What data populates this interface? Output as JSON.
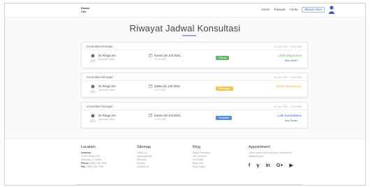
{
  "nav": {
    "logo_line1": "Dokter",
    "logo_line2": "Cek",
    "links": [
      "Home",
      "Riwayat",
      "Cerita",
      "Masuk Akun"
    ]
  },
  "page": {
    "title": "Riwayat Jadwal Konsultasi"
  },
  "cards": [
    {
      "heading": "Konsultasi Dengan",
      "date_posted": "12 Juni 2021 · 10.00 WIB",
      "doctor": "Dr.Ringo,sm",
      "specialty": "Spesialis Mata",
      "schedule_date": "Kamis,29 Juli 2021",
      "schedule_time": "11.00 WIB",
      "status": "Selesai",
      "status_color": "#5cb85c",
      "action": "Lihat Diagnosa",
      "action_color": "#5cb85c",
      "action_sub": "Ulas Dokter"
    },
    {
      "heading": "Konsultasi Dengan",
      "date_posted": "12 Juni 2021 · 10.00 WIB",
      "doctor": "Dr.Ringo,sm",
      "specialty": "Spesialis Mata",
      "schedule_date": "Sabtu,31 Juli 2021",
      "schedule_time": "11.00 WIB",
      "status": "Menunggu",
      "status_color": "#f5c542",
      "action": "Bayar Sekarang",
      "action_color": "#f0ad4e",
      "action_sub": ""
    },
    {
      "heading": "Konsultasi Dengan",
      "date_posted": "12 Juni 2021 · 10.00 WIB",
      "doctor": "Dr.Ringo,sm",
      "specialty": "Spesialis Mata",
      "schedule_date": "Kamis,29 Juli 2021",
      "schedule_time": "11.00 WIB",
      "status": "Terjadwal",
      "status_color": "#4a90e2",
      "action": "Link Konsultasi",
      "action_color": "#3a5bd9",
      "action_sub": "Ulas Dokter"
    }
  ],
  "footer": {
    "location": {
      "heading": "Location",
      "address_label": "Address:",
      "address_1": "1025 Tuff Ave Rd.",
      "address_2": "Hulubalu, IL 76303",
      "phone_label": "Phone:",
      "phone": "(555) 236-7818",
      "fax_label": "Fax:",
      "fax": "(555) 265-7818"
    },
    "sitemap": {
      "heading": "Sitemap",
      "items": [
        "About Us",
        "Appointments",
        "Services",
        "Doctors",
        "Contact Us"
      ]
    },
    "blog": {
      "heading": "Blog",
      "items": [
        "Rapid Recovery",
        "Get Involved",
        "Full Width",
        "Blog Grid",
        "Blog Single"
      ]
    },
    "appointment": {
      "heading": "Appointment",
      "text_1": "Lorem ipsum dolor sit amet, consectetur",
      "text_2": "adipiscing elit.",
      "social": [
        "f",
        "𝕪",
        "in",
        "G+",
        "▶"
      ]
    }
  }
}
